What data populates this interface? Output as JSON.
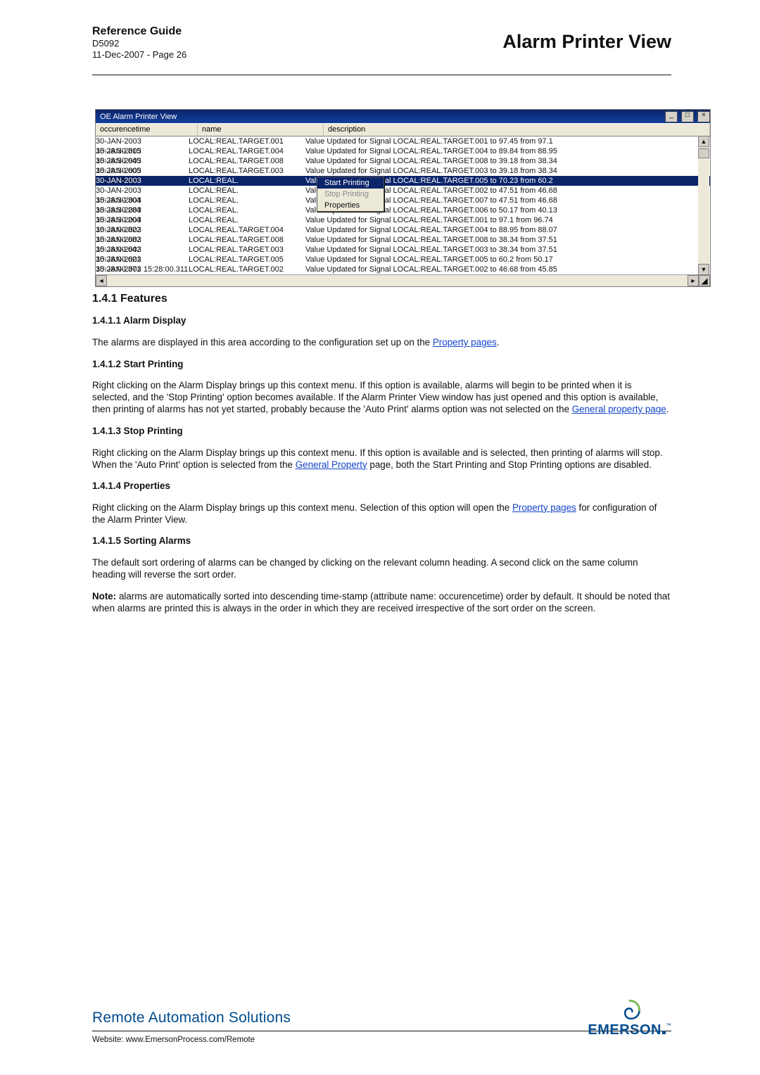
{
  "header": {
    "title": "Reference Guide",
    "doc": "D5092",
    "page": "11-Dec-2007 - Page 26",
    "right": "Alarm Printer View"
  },
  "shot": {
    "title": "OE Alarm Printer View",
    "btn_min": "_",
    "btn_max": "□",
    "btn_close": "×",
    "col1": "occurencetime",
    "col2": "name",
    "col3": "description",
    "rows": [
      {
        "t": "30-JAN-2003 15:28:30.815",
        "n": "LOCAL:REAL.TARGET.001",
        "d": "Value Updated for Signal LOCAL:REAL.TARGET.001 to 97.45 from 97.1"
      },
      {
        "t": "30-JAN-2003 15:28:30.645",
        "n": "LOCAL:REAL.TARGET.004",
        "d": "Value Updated for Signal LOCAL:REAL.TARGET.004 to 89.84 from 88.95"
      },
      {
        "t": "30-JAN-2003 15:28:30.605",
        "n": "LOCAL:REAL.TARGET.008",
        "d": "Value Updated for Signal LOCAL:REAL.TARGET.008 to 39.18 from 38.34"
      },
      {
        "t": "30-JAN-2003 15:28:30.595",
        "n": "LOCAL:REAL.TARGET.003",
        "d": "Value Updated for Signal LOCAL:REAL.TARGET.003 to 39.18 from 38.34"
      },
      {
        "t": "30-JAN-2003 15:28:30.354",
        "n": "LOCAL:REAL.",
        "d": "Value Updated for Signal LOCAL:REAL.TARGET.005 to 70.23 from 60.2"
      },
      {
        "t": "30-JAN-2003 15:28:30.304",
        "n": "LOCAL:REAL.",
        "d": "Value Updated for Signal LOCAL:REAL.TARGET.002 to 47.51 from 46.68"
      },
      {
        "t": "30-JAN-2003 15:28:30.284",
        "n": "LOCAL:REAL.",
        "d": "Value Updated for Signal LOCAL:REAL.TARGET.007 to 47.51 from 46.68"
      },
      {
        "t": "30-JAN-2003 15:28:30.204",
        "n": "LOCAL:REAL.",
        "d": "Value Updated for Signal LOCAL:REAL.TARGET.006 to 50.17 from 40.13"
      },
      {
        "t": "30-JAN-2003 15:28:00.822",
        "n": "LOCAL:REAL.",
        "d": "Value Updated for Signal LOCAL:REAL.TARGET.001 to 97.1 from 96.74"
      },
      {
        "t": "30-JAN-2003 15:28:00.682",
        "n": "LOCAL:REAL.TARGET.004",
        "d": "Value Updated for Signal LOCAL:REAL.TARGET.004 to 88.95 from 88.07"
      },
      {
        "t": "30-JAN-2003 15:28:00.642",
        "n": "LOCAL:REAL.TARGET.008",
        "d": "Value Updated for Signal LOCAL:REAL.TARGET.008 to 38.34 from 37.51"
      },
      {
        "t": "30-JAN-2003 15:28:00.621",
        "n": "LOCAL:REAL.TARGET.003",
        "d": "Value Updated for Signal LOCAL:REAL.TARGET.003 to 38.34 from 37.51"
      },
      {
        "t": "30-JAN-2003 15:28:00.371",
        "n": "LOCAL:REAL.TARGET.005",
        "d": "Value Updated for Signal LOCAL:REAL.TARGET.005 to 60.2 from 50.17"
      },
      {
        "t": "30-JAN-2003 15:28:00.311",
        "n": "LOCAL:REAL.TARGET.002",
        "d": "Value Updated for Signal LOCAL:REAL.TARGET.002 to 46.68 from 45.85"
      }
    ],
    "menu": {
      "start": "Start Printing",
      "stop": "Stop Printing",
      "props": "Properties"
    }
  },
  "sec": {
    "h3": "1.4.1      Features",
    "h4_1": "1.4.1.1        Alarm Display",
    "p1a": "The alarms are displayed in this area according to the configuration set up on the ",
    "p1l": "Property pages",
    "p1b": ".",
    "h4_2": "1.4.1.2        Start Printing",
    "p2a": "Right clicking on the Alarm Display brings up this context menu. If this option is available, alarms will begin to be printed when it is selected, and the 'Stop Printing' option becomes available. If the Alarm Printer View window has just opened and this option is available, then printing of alarms has not yet started, probably because the 'Auto Print' alarms option was not selected on the ",
    "p2l": "General property page",
    "p2b": ".",
    "h4_3": "1.4.1.3        Stop Printing",
    "p3a": "Right clicking on the Alarm Display brings up this context menu. If this option is available and is selected, then printing of alarms will stop. When the 'Auto Print' option is selected from the ",
    "p3l": "General Property",
    "p3b": " page, both the Start Printing and Stop Printing options are disabled.",
    "h4_4": "1.4.1.4        Properties",
    "p4a": "Right clicking on the Alarm Display brings up this context menu. Selection of this option will open the ",
    "p4l": "Property pages",
    "p4b": " for configuration of the Alarm Printer View.",
    "h4_5": "1.4.1.5        Sorting Alarms",
    "p5": "The default sort ordering of alarms can be changed by clicking on the relevant column heading. A second click on the same column heading will reverse the sort order.",
    "note_l": "Note:",
    "note_b": " alarms are automatically sorted into descending time-stamp (attribute name: occurencetime) order by default. It should be noted that when alarms are printed this is always in the order in which they are received irrespective of the sort order on the screen."
  },
  "footer": {
    "ras": "Remote Automation Solutions",
    "web": "Website:  www.EmersonProcess.com/Remote",
    "emerson": "EMERSON"
  }
}
